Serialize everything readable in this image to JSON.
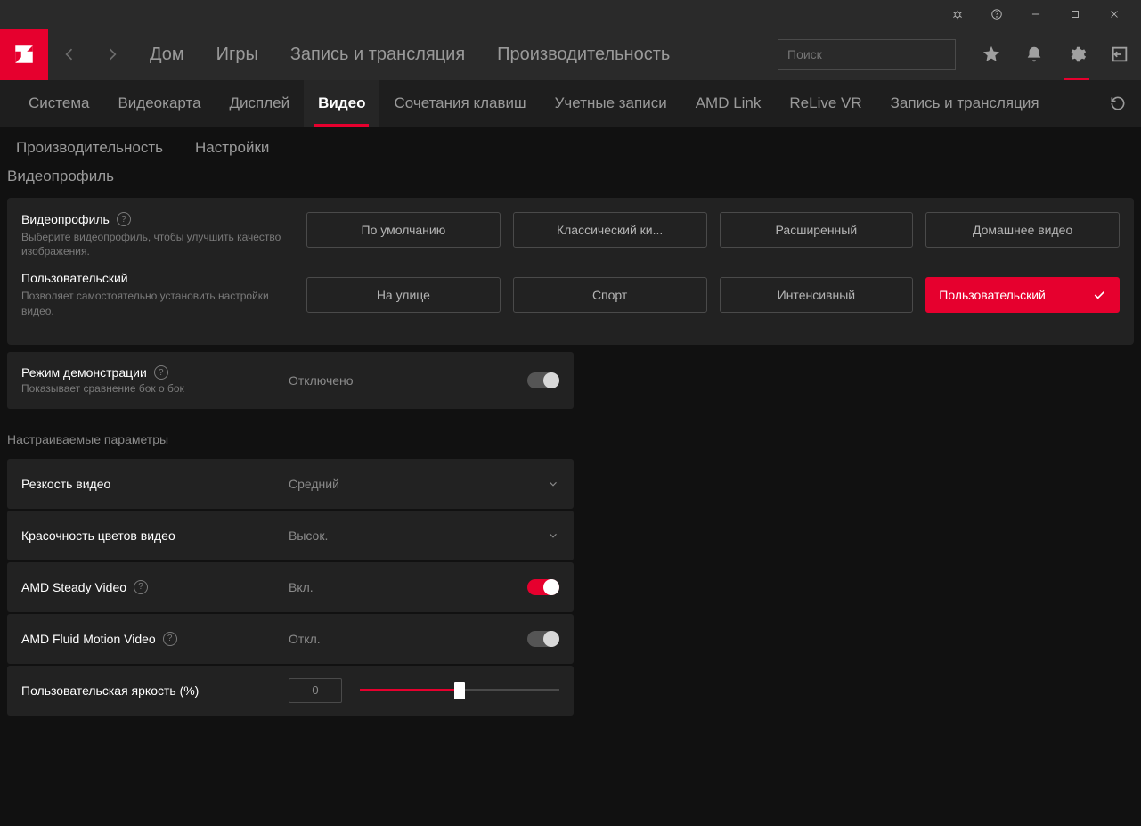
{
  "titlebar": {},
  "header": {
    "nav": [
      "Дом",
      "Игры",
      "Запись и трансляция",
      "Производительность"
    ],
    "search_placeholder": "Поиск"
  },
  "tabs": {
    "items": [
      "Система",
      "Видеокарта",
      "Дисплей",
      "Видео",
      "Сочетания клавиш",
      "Учетные записи",
      "AMD Link",
      "ReLive VR",
      "Запись и трансляция"
    ],
    "active_index": 3
  },
  "subtabs": {
    "items": [
      "Производительность",
      "Настройки"
    ]
  },
  "section_title": "Видеопрофиль",
  "profile_panel": {
    "title": "Видеопрофиль",
    "desc": "Выберите видеопрофиль, чтобы улучшить качество изображения.",
    "custom_title": "Пользовательский",
    "custom_desc": "Позволяет самостоятельно установить настройки видео.",
    "options": [
      "По умолчанию",
      "Классический ки...",
      "Расширенный",
      "Домашнее видео",
      "На улице",
      "Спорт",
      "Интенсивный",
      "Пользовательский"
    ],
    "active_index": 7
  },
  "demo_row": {
    "label": "Режим демонстрации",
    "sub": "Показывает сравнение бок о бок",
    "status": "Отключено",
    "on": false
  },
  "params_label": "Настраиваемые параметры",
  "params": {
    "sharpness": {
      "label": "Резкость видео",
      "value": "Средний"
    },
    "vibrance": {
      "label": "Красочность цветов видео",
      "value": "Высок."
    },
    "steady": {
      "label": "AMD Steady Video",
      "status": "Вкл.",
      "on": true
    },
    "fluid": {
      "label": "AMD Fluid Motion Video",
      "status": "Откл.",
      "on": false
    },
    "brightness": {
      "label": "Пользовательская яркость (%)",
      "value": "0",
      "percent": 50
    }
  }
}
